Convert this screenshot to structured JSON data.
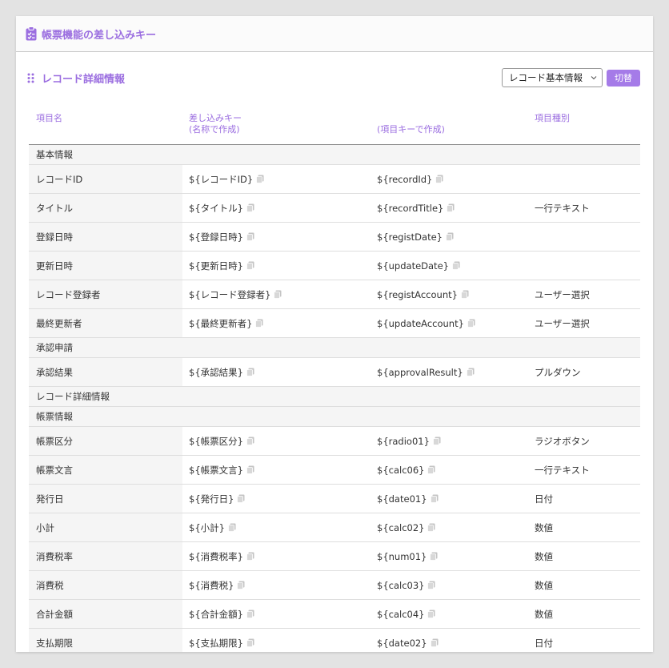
{
  "header": {
    "title": "帳票機能の差し込みキー",
    "icon": "clipboard-icon"
  },
  "section": {
    "title": "レコード詳細情報",
    "select_value": "レコード基本情報",
    "switch_label": "切替"
  },
  "colors": {
    "accent": "#9b6ee0",
    "button": "#a57be8"
  },
  "table": {
    "headers": {
      "name": "項目名",
      "key_name_line1": "差し込みキー",
      "key_name_line2": "(名称で作成)",
      "key_id": "(項目キーで作成)",
      "type": "項目種別"
    },
    "groups": [
      {
        "label": "基本情報",
        "rows": [
          {
            "name": "レコードID",
            "key_name": "${レコードID}",
            "key_id": "${recordId}",
            "type": ""
          },
          {
            "name": "タイトル",
            "key_name": "${タイトル}",
            "key_id": "${recordTitle}",
            "type": "一行テキスト"
          },
          {
            "name": "登録日時",
            "key_name": "${登録日時}",
            "key_id": "${registDate}",
            "type": ""
          },
          {
            "name": "更新日時",
            "key_name": "${更新日時}",
            "key_id": "${updateDate}",
            "type": ""
          },
          {
            "name": "レコード登録者",
            "key_name": "${レコード登録者}",
            "key_id": "${registAccount}",
            "type": "ユーザー選択"
          },
          {
            "name": "最終更新者",
            "key_name": "${最終更新者}",
            "key_id": "${updateAccount}",
            "type": "ユーザー選択"
          }
        ]
      },
      {
        "label": "承認申請",
        "rows": [
          {
            "name": "承認結果",
            "key_name": "${承認結果}",
            "key_id": "${approvalResult}",
            "type": "プルダウン"
          }
        ]
      },
      {
        "label": "レコード詳細情報",
        "rows": []
      },
      {
        "label": "帳票情報",
        "rows": [
          {
            "name": "帳票区分",
            "key_name": "${帳票区分}",
            "key_id": "${radio01}",
            "type": "ラジオボタン"
          },
          {
            "name": "帳票文言",
            "key_name": "${帳票文言}",
            "key_id": "${calc06}",
            "type": "一行テキスト"
          },
          {
            "name": "発行日",
            "key_name": "${発行日}",
            "key_id": "${date01}",
            "type": "日付"
          },
          {
            "name": "小計",
            "key_name": "${小計}",
            "key_id": "${calc02}",
            "type": "数値"
          },
          {
            "name": "消費税率",
            "key_name": "${消費税率}",
            "key_id": "${num01}",
            "type": "数値"
          },
          {
            "name": "消費税",
            "key_name": "${消費税}",
            "key_id": "${calc03}",
            "type": "数値"
          },
          {
            "name": "合計金額",
            "key_name": "${合計金額}",
            "key_id": "${calc04}",
            "type": "数値"
          },
          {
            "name": "支払期限",
            "key_name": "${支払期限}",
            "key_id": "${date02}",
            "type": "日付"
          }
        ]
      }
    ]
  }
}
